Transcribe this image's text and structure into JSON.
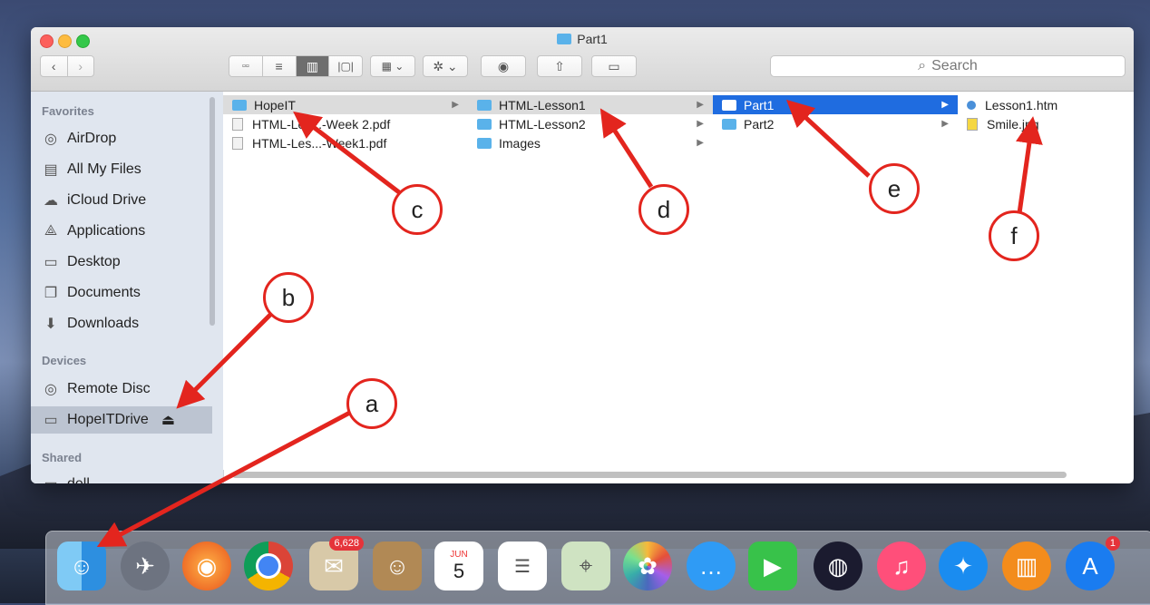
{
  "window": {
    "title": "Part1"
  },
  "search": {
    "placeholder": "Search"
  },
  "sidebar": {
    "favorites_label": "Favorites",
    "favorites": [
      {
        "label": "AirDrop",
        "icon": "airdrop-icon"
      },
      {
        "label": "All My Files",
        "icon": "all-files-icon"
      },
      {
        "label": "iCloud Drive",
        "icon": "cloud-icon"
      },
      {
        "label": "Applications",
        "icon": "applications-icon"
      },
      {
        "label": "Desktop",
        "icon": "desktop-icon"
      },
      {
        "label": "Documents",
        "icon": "documents-icon"
      },
      {
        "label": "Downloads",
        "icon": "downloads-icon"
      }
    ],
    "devices_label": "Devices",
    "devices": [
      {
        "label": "Remote Disc",
        "icon": "disc-icon"
      },
      {
        "label": "HopeITDrive",
        "icon": "drive-icon",
        "eject": "⏏"
      }
    ],
    "shared_label": "Shared",
    "shared": [
      {
        "label": "dell",
        "icon": "computer-icon"
      }
    ]
  },
  "columns": [
    [
      {
        "label": "HopeIT",
        "type": "folder"
      },
      {
        "label": "HTML-Les...-Week 2.pdf",
        "type": "file"
      },
      {
        "label": "HTML-Les...-Week1.pdf",
        "type": "file"
      }
    ],
    [
      {
        "label": "HTML-Lesson1",
        "type": "folder"
      },
      {
        "label": "HTML-Lesson2",
        "type": "folder"
      },
      {
        "label": "Images",
        "type": "folder"
      }
    ],
    [
      {
        "label": "Part1",
        "type": "folder"
      },
      {
        "label": "Part2",
        "type": "folder"
      }
    ],
    [
      {
        "label": "Lesson1.htm",
        "type": "file"
      },
      {
        "label": "Smile.jpg",
        "type": "file"
      }
    ]
  ],
  "dock": {
    "mail_badge": "6,628",
    "calendar_month": "JUN",
    "calendar_day": "5",
    "appstore_badge": "1"
  },
  "annotations": [
    "a",
    "b",
    "c",
    "d",
    "e",
    "f"
  ],
  "colors": {
    "selection_blue": "#1f6ce0",
    "annotation_red": "#e3251e",
    "folder_blue": "#5ab2ea"
  }
}
